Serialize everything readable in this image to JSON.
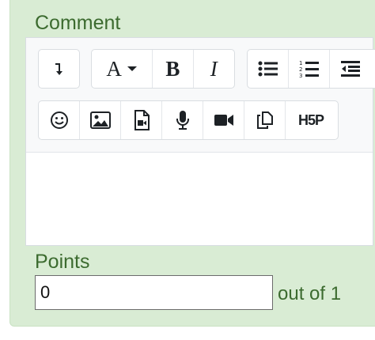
{
  "comment": {
    "label": "Comment"
  },
  "editor": {
    "toolbar_row1": [
      {
        "name": "text-direction-button",
        "icon": "arrow-down-icon"
      },
      {
        "name": "font-style-button",
        "icon": "font-dropdown-icon",
        "text": "A"
      },
      {
        "name": "bold-button",
        "icon": "bold-icon",
        "text": "B"
      },
      {
        "name": "italic-button",
        "icon": "italic-icon",
        "text": "I"
      },
      {
        "name": "unordered-list-button",
        "icon": "bullet-list-icon"
      },
      {
        "name": "ordered-list-button",
        "icon": "numbered-list-icon"
      },
      {
        "name": "outdent-button",
        "icon": "outdent-icon"
      }
    ],
    "toolbar_row2": [
      {
        "name": "emoji-button",
        "icon": "smiley-icon"
      },
      {
        "name": "image-button",
        "icon": "image-icon"
      },
      {
        "name": "media-button",
        "icon": "media-file-icon"
      },
      {
        "name": "record-audio-button",
        "icon": "microphone-icon"
      },
      {
        "name": "record-video-button",
        "icon": "video-camera-icon"
      },
      {
        "name": "manage-files-button",
        "icon": "copy-files-icon"
      },
      {
        "name": "h5p-button",
        "icon": "h5p-icon",
        "text": "H5P"
      }
    ],
    "content": ""
  },
  "points": {
    "label": "Points",
    "value": "0",
    "out_of": "out of 1"
  },
  "colors": {
    "panel_bg": "#d9ecd4",
    "label_text": "#3c6b2f",
    "toolbar_bg": "#f8f9fa"
  }
}
